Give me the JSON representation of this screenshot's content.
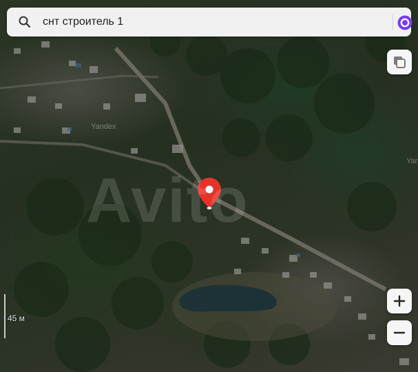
{
  "search": {
    "query": "снт строитель 1"
  },
  "map": {
    "scale_label": "45 м",
    "watermark": "Avito",
    "provider_label": "Yandex",
    "pin_color": "#e6332a"
  },
  "controls": {
    "zoom_in": "+",
    "zoom_out": "−"
  },
  "icons": [
    "search-icon",
    "alice-icon",
    "layers-icon",
    "location-pin-icon"
  ],
  "colors": {
    "accent": "#7b3cf0",
    "pin": "#e6332a"
  }
}
